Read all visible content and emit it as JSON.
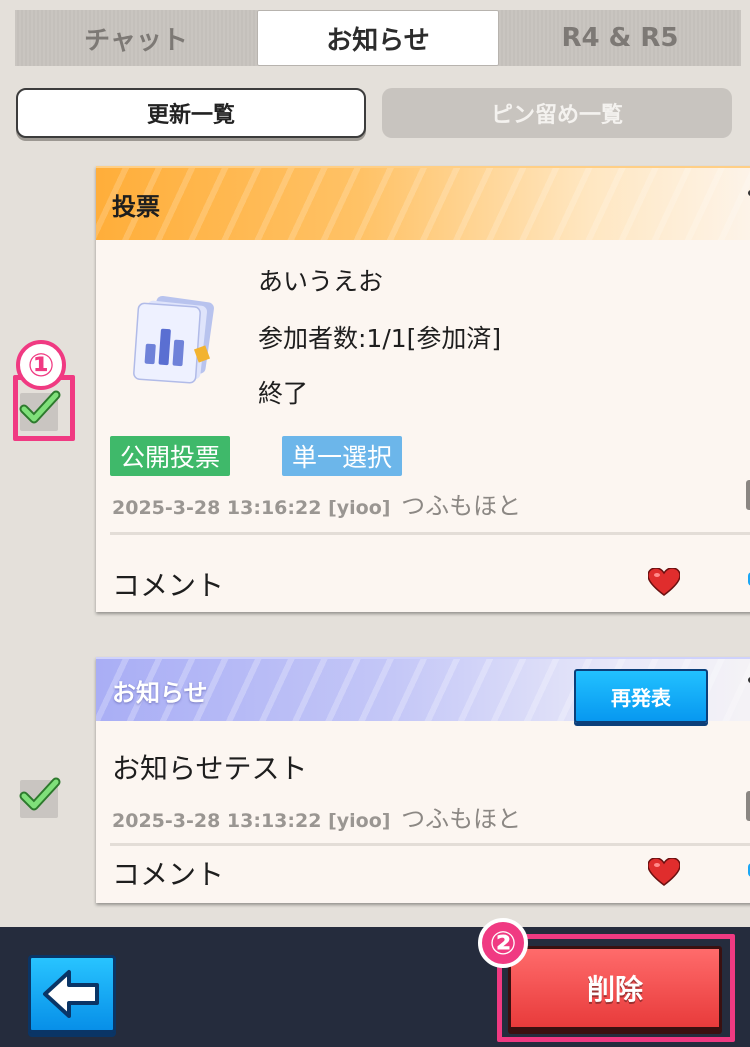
{
  "top_tabs": [
    {
      "label": "チャット",
      "active": false
    },
    {
      "label": "お知らせ",
      "active": true
    },
    {
      "label": "R4 & R5",
      "active": false
    }
  ],
  "sub_tabs": [
    {
      "label": "更新一覧",
      "active": true
    },
    {
      "label": "ピン留め一覧",
      "active": false
    }
  ],
  "posts": [
    {
      "header": "投票",
      "icon": "poll-chart-icon",
      "title": "あいうえお",
      "participants": "参加者数:1/1[参加済]",
      "status": "終了",
      "tags": [
        "公開投票",
        "単一選択"
      ],
      "timestamp": "2025-3-28 13:16:22",
      "alliance": "[yioo]",
      "author": "つふもほと",
      "comment_label": "コメント",
      "checked": true,
      "marker": "①"
    },
    {
      "header": "お知らせ",
      "republish_label": "再発表",
      "body": "お知らせテスト",
      "timestamp": "2025-3-28 13:13:22",
      "alliance": "[yioo]",
      "author": "つふもほと",
      "comment_label": "コメント",
      "checked": true
    }
  ],
  "footer": {
    "back_icon": "arrow-left-icon",
    "delete_label": "削除",
    "marker": "②"
  },
  "colors": {
    "accent_pink": "#f03a82",
    "delete_red": "#e83b3b",
    "republish_blue": "#0798f0",
    "tag_green": "#3fb96a",
    "tag_blue": "#6cb6ea"
  }
}
